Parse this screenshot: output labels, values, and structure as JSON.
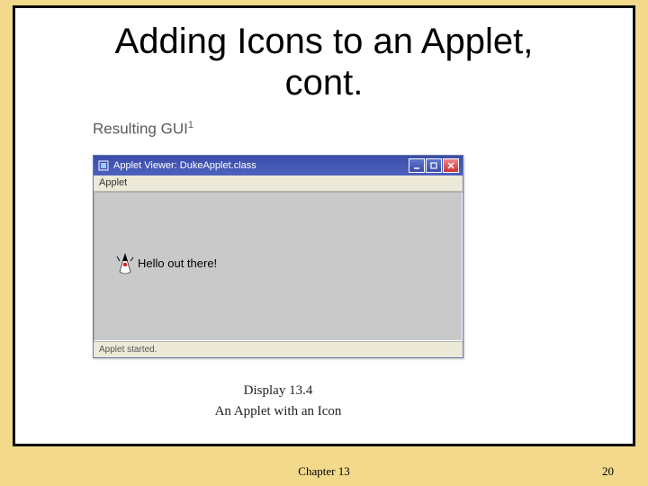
{
  "slide": {
    "title_line1": "Adding Icons to an Applet,",
    "title_line2": "cont."
  },
  "resulting_label": {
    "text": "Resulting GUI",
    "footnote": "1"
  },
  "applet_window": {
    "title": "Applet Viewer: DukeApplet.class",
    "menu": {
      "applet": "Applet"
    },
    "body_text": "Hello out there!",
    "status": "Applet started."
  },
  "caption": {
    "number": "Display 13.4",
    "description": "An Applet with an Icon"
  },
  "footer": {
    "chapter": "Chapter 13",
    "page": "20"
  },
  "icons": {
    "titlebar_app": "applet-icon",
    "min": "minimize-icon",
    "max": "maximize-icon",
    "close": "close-icon",
    "duke": "duke-icon"
  }
}
